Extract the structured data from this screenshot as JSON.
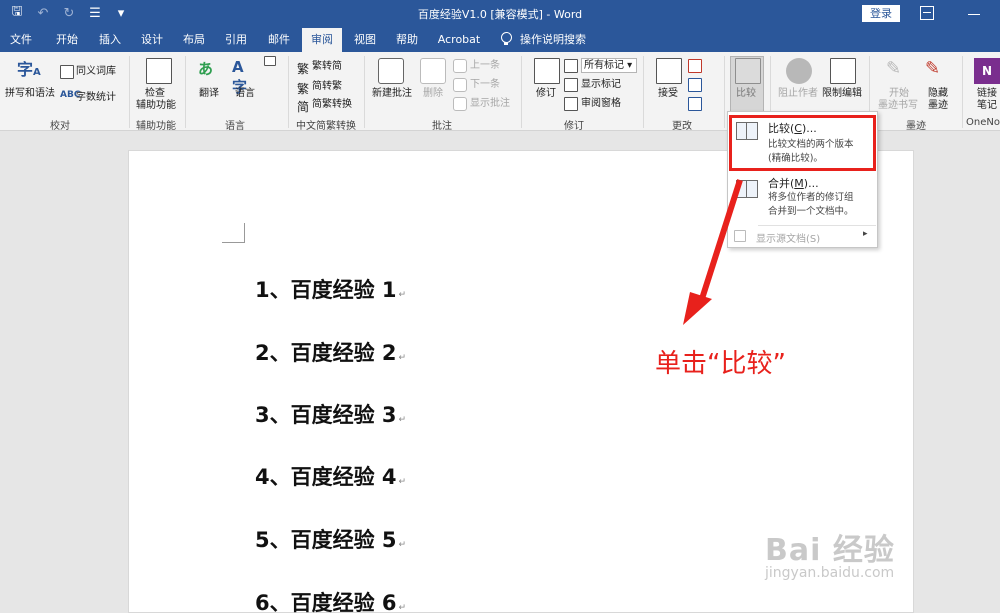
{
  "window": {
    "title": "百度经验V1.0 [兼容模式] - Word",
    "login_label": "登录"
  },
  "tabs": [
    {
      "label": "文件"
    },
    {
      "label": "开始"
    },
    {
      "label": "插入"
    },
    {
      "label": "设计"
    },
    {
      "label": "布局"
    },
    {
      "label": "引用"
    },
    {
      "label": "邮件"
    },
    {
      "label": "审阅",
      "active": true
    },
    {
      "label": "视图"
    },
    {
      "label": "帮助"
    },
    {
      "label": "Acrobat"
    },
    {
      "label": "操作说明搜索"
    }
  ],
  "ribbon": {
    "proofing": {
      "spelling": "拼写和语法",
      "thesaurus": "同义词库",
      "word_count": "字数统计",
      "group": "校对"
    },
    "accessibility": {
      "check_line1": "检查",
      "check_line2": "辅助功能",
      "group": "辅助功能"
    },
    "language": {
      "translate": "翻译",
      "language": "语言",
      "group": "语言"
    },
    "chinese": {
      "to_simplified": "繁转简",
      "to_traditional": "简转繁",
      "convert": "简繁转换",
      "group": "中文简繁转换"
    },
    "comments": {
      "new_comment": "新建批注",
      "delete": "删除",
      "previous": "上一条",
      "next": "下一条",
      "show_comments": "显示批注",
      "group": "批注"
    },
    "tracking": {
      "track": "修订",
      "all_markup": "所有标记",
      "show_markup": "显示标记",
      "review_pane": "审阅窗格",
      "group": "修订"
    },
    "changes": {
      "accept": "接受",
      "group": "更改"
    },
    "compare": {
      "compare": "比较"
    },
    "protect": {
      "block_authors": "阻止作者",
      "restrict_editing": "限制编辑"
    },
    "ink": {
      "start_line1": "开始",
      "start_line2": "墨迹书写",
      "hide_line1": "隐藏",
      "hide_line2": "墨迹",
      "group": "墨迹"
    },
    "onenote": {
      "link_line1": "链接",
      "link_line2": "笔记",
      "group": "OneNo"
    }
  },
  "compare_menu": {
    "compare_title": "比较(",
    "compare_key": "C",
    "compare_title_end": ")...",
    "compare_desc1": "比较文档的两个版本",
    "compare_desc2": "(精确比较)。",
    "combine_title": "合并(",
    "combine_key": "M",
    "combine_title_end": ")...",
    "combine_desc1": "将多位作者的修订组",
    "combine_desc2": "合并到一个文档中。",
    "show_source": "显示源文档(S)"
  },
  "document": {
    "headings": [
      "1、百度经验 1",
      "2、百度经验 2",
      "3、百度经验 3",
      "4、百度经验 4",
      "5、百度经验 5",
      "6、百度经验 6"
    ]
  },
  "annotation": {
    "text": "单击“比较”",
    "color": "#e8211c"
  },
  "watermark": {
    "main": "Bai 经验",
    "sub": "jingyan.baidu.com"
  },
  "colors": {
    "brand_blue": "#2b579a",
    "highlight_red": "#e8211c"
  }
}
